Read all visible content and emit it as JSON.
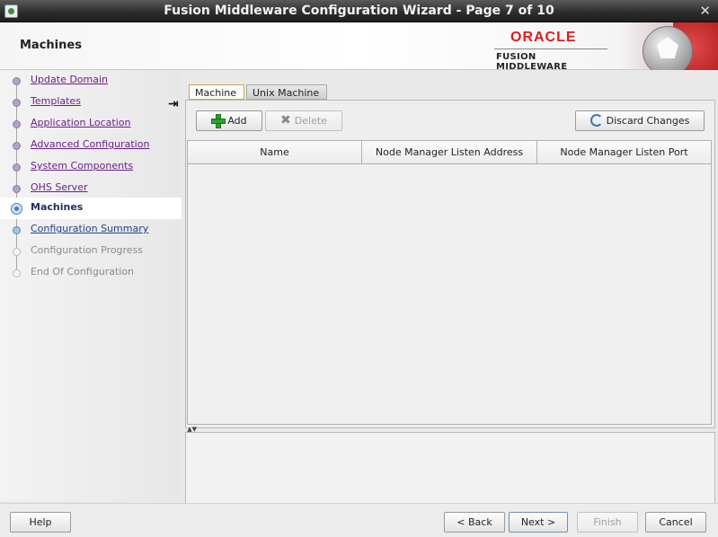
{
  "window": {
    "title": "Fusion Middleware Configuration Wizard - Page 7 of 10",
    "close_glyph": "✕"
  },
  "header": {
    "page_title": "Machines",
    "logo_word": "ORACLE",
    "logo_sub": "FUSION MIDDLEWARE",
    "accent_color": "#e01b1b"
  },
  "nav": {
    "items": [
      {
        "label": "Update Domain",
        "state": "visited"
      },
      {
        "label": "Templates",
        "state": "visited"
      },
      {
        "label": "Application Location",
        "state": "visited"
      },
      {
        "label": "Advanced Configuration",
        "state": "visited"
      },
      {
        "label": "System Components",
        "state": "visited"
      },
      {
        "label": "OHS Server",
        "state": "visited"
      },
      {
        "label": "Machines",
        "state": "current"
      },
      {
        "label": "Configuration Summary",
        "state": "next"
      },
      {
        "label": "Configuration Progress",
        "state": "pending"
      },
      {
        "label": "End Of Configuration",
        "state": "pending"
      }
    ]
  },
  "tabs": [
    {
      "label": "Machine",
      "active": true
    },
    {
      "label": "Unix Machine",
      "active": false
    }
  ],
  "toolbar": {
    "add_label": "Add",
    "delete_label": "Delete",
    "discard_label": "Discard Changes"
  },
  "table": {
    "columns": [
      "Name",
      "Node Manager Listen Address",
      "Node Manager Listen Port"
    ],
    "rows": []
  },
  "footer": {
    "help": "Help",
    "back": "< Back",
    "next": "Next >",
    "finish": "Finish",
    "cancel": "Cancel"
  }
}
